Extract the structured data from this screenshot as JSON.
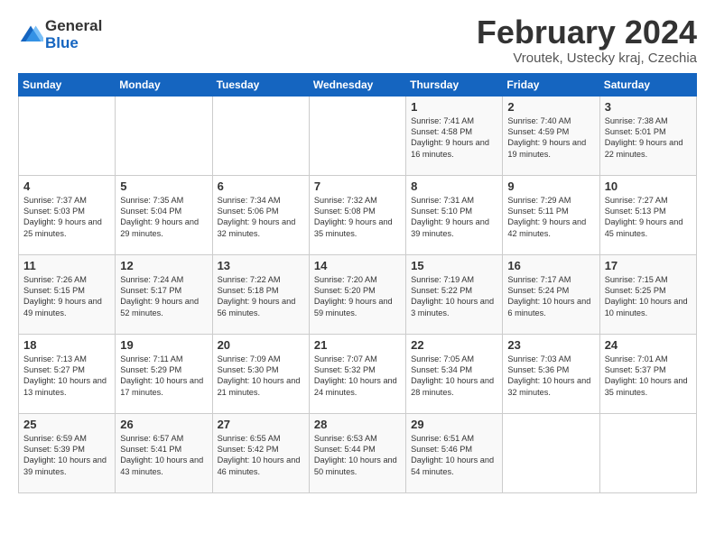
{
  "header": {
    "logo_line1": "General",
    "logo_line2": "Blue",
    "month_title": "February 2024",
    "location": "Vroutek, Ustecky kraj, Czechia"
  },
  "days_of_week": [
    "Sunday",
    "Monday",
    "Tuesday",
    "Wednesday",
    "Thursday",
    "Friday",
    "Saturday"
  ],
  "weeks": [
    [
      {
        "day": "",
        "content": ""
      },
      {
        "day": "",
        "content": ""
      },
      {
        "day": "",
        "content": ""
      },
      {
        "day": "",
        "content": ""
      },
      {
        "day": "1",
        "content": "Sunrise: 7:41 AM\nSunset: 4:58 PM\nDaylight: 9 hours\nand 16 minutes."
      },
      {
        "day": "2",
        "content": "Sunrise: 7:40 AM\nSunset: 4:59 PM\nDaylight: 9 hours\nand 19 minutes."
      },
      {
        "day": "3",
        "content": "Sunrise: 7:38 AM\nSunset: 5:01 PM\nDaylight: 9 hours\nand 22 minutes."
      }
    ],
    [
      {
        "day": "4",
        "content": "Sunrise: 7:37 AM\nSunset: 5:03 PM\nDaylight: 9 hours\nand 25 minutes."
      },
      {
        "day": "5",
        "content": "Sunrise: 7:35 AM\nSunset: 5:04 PM\nDaylight: 9 hours\nand 29 minutes."
      },
      {
        "day": "6",
        "content": "Sunrise: 7:34 AM\nSunset: 5:06 PM\nDaylight: 9 hours\nand 32 minutes."
      },
      {
        "day": "7",
        "content": "Sunrise: 7:32 AM\nSunset: 5:08 PM\nDaylight: 9 hours\nand 35 minutes."
      },
      {
        "day": "8",
        "content": "Sunrise: 7:31 AM\nSunset: 5:10 PM\nDaylight: 9 hours\nand 39 minutes."
      },
      {
        "day": "9",
        "content": "Sunrise: 7:29 AM\nSunset: 5:11 PM\nDaylight: 9 hours\nand 42 minutes."
      },
      {
        "day": "10",
        "content": "Sunrise: 7:27 AM\nSunset: 5:13 PM\nDaylight: 9 hours\nand 45 minutes."
      }
    ],
    [
      {
        "day": "11",
        "content": "Sunrise: 7:26 AM\nSunset: 5:15 PM\nDaylight: 9 hours\nand 49 minutes."
      },
      {
        "day": "12",
        "content": "Sunrise: 7:24 AM\nSunset: 5:17 PM\nDaylight: 9 hours\nand 52 minutes."
      },
      {
        "day": "13",
        "content": "Sunrise: 7:22 AM\nSunset: 5:18 PM\nDaylight: 9 hours\nand 56 minutes."
      },
      {
        "day": "14",
        "content": "Sunrise: 7:20 AM\nSunset: 5:20 PM\nDaylight: 9 hours\nand 59 minutes."
      },
      {
        "day": "15",
        "content": "Sunrise: 7:19 AM\nSunset: 5:22 PM\nDaylight: 10 hours\nand 3 minutes."
      },
      {
        "day": "16",
        "content": "Sunrise: 7:17 AM\nSunset: 5:24 PM\nDaylight: 10 hours\nand 6 minutes."
      },
      {
        "day": "17",
        "content": "Sunrise: 7:15 AM\nSunset: 5:25 PM\nDaylight: 10 hours\nand 10 minutes."
      }
    ],
    [
      {
        "day": "18",
        "content": "Sunrise: 7:13 AM\nSunset: 5:27 PM\nDaylight: 10 hours\nand 13 minutes."
      },
      {
        "day": "19",
        "content": "Sunrise: 7:11 AM\nSunset: 5:29 PM\nDaylight: 10 hours\nand 17 minutes."
      },
      {
        "day": "20",
        "content": "Sunrise: 7:09 AM\nSunset: 5:30 PM\nDaylight: 10 hours\nand 21 minutes."
      },
      {
        "day": "21",
        "content": "Sunrise: 7:07 AM\nSunset: 5:32 PM\nDaylight: 10 hours\nand 24 minutes."
      },
      {
        "day": "22",
        "content": "Sunrise: 7:05 AM\nSunset: 5:34 PM\nDaylight: 10 hours\nand 28 minutes."
      },
      {
        "day": "23",
        "content": "Sunrise: 7:03 AM\nSunset: 5:36 PM\nDaylight: 10 hours\nand 32 minutes."
      },
      {
        "day": "24",
        "content": "Sunrise: 7:01 AM\nSunset: 5:37 PM\nDaylight: 10 hours\nand 35 minutes."
      }
    ],
    [
      {
        "day": "25",
        "content": "Sunrise: 6:59 AM\nSunset: 5:39 PM\nDaylight: 10 hours\nand 39 minutes."
      },
      {
        "day": "26",
        "content": "Sunrise: 6:57 AM\nSunset: 5:41 PM\nDaylight: 10 hours\nand 43 minutes."
      },
      {
        "day": "27",
        "content": "Sunrise: 6:55 AM\nSunset: 5:42 PM\nDaylight: 10 hours\nand 46 minutes."
      },
      {
        "day": "28",
        "content": "Sunrise: 6:53 AM\nSunset: 5:44 PM\nDaylight: 10 hours\nand 50 minutes."
      },
      {
        "day": "29",
        "content": "Sunrise: 6:51 AM\nSunset: 5:46 PM\nDaylight: 10 hours\nand 54 minutes."
      },
      {
        "day": "",
        "content": ""
      },
      {
        "day": "",
        "content": ""
      }
    ]
  ]
}
